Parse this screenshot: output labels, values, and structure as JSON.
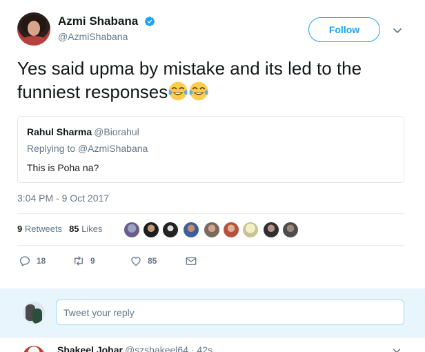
{
  "author": {
    "display_name": "Azmi Shabana",
    "handle": "@AzmiShabana",
    "verified": true,
    "follow_label": "Follow"
  },
  "tweet": {
    "text_line1": "Yes said upma by mistake and its led to the",
    "text_line2": "funniest responses",
    "emojis": [
      "face-with-tears-of-joy",
      "face-with-tears-of-joy"
    ],
    "timestamp": "3:04 PM - 9 Oct 2017"
  },
  "quote": {
    "name": "Rahul Sharma",
    "handle": "@Biorahul",
    "replying_prefix": "Replying to",
    "replying_handle": "@AzmiShabana",
    "text": "This is Poha na?"
  },
  "stats": {
    "retweets_count": "9",
    "retweets_label": "Retweets",
    "likes_count": "85",
    "likes_label": "Likes"
  },
  "actions": {
    "reply_count": "18",
    "retweet_count": "9",
    "like_count": "85"
  },
  "reply_box": {
    "placeholder": "Tweet your reply"
  },
  "next_tweet": {
    "name": "Shakeel Johar",
    "handle": "@szshakeel64 · 42s"
  },
  "colors": {
    "accent": "#1da1f2",
    "secondary_text": "#657786",
    "reply_bar_bg": "#e8f5fd"
  }
}
